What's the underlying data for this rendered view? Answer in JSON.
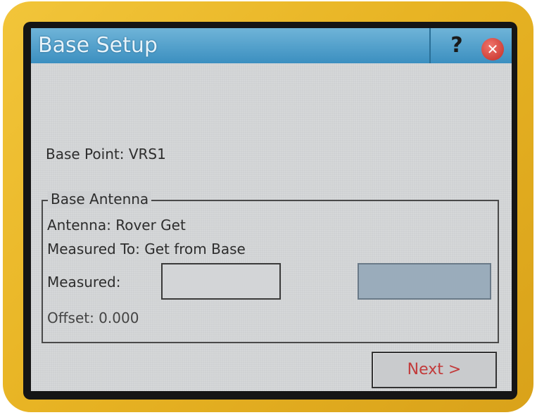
{
  "window": {
    "title": "Base Setup",
    "help_glyph": "?",
    "close_glyph": "✕"
  },
  "base_point": {
    "text": "Base Point: VRS1"
  },
  "base_antenna": {
    "group_label": "Base Antenna",
    "antenna_text": "Antenna: Rover Get",
    "measured_to_text": "Measured To: Get from Base",
    "measured_label": "Measured:",
    "measured_value": "",
    "offset_text": "Offset: 0.000"
  },
  "footer": {
    "next_label": "Next >"
  },
  "colors": {
    "titlebar": "#3b8fc0",
    "device_body": "#e8b424",
    "next_text": "#c23b3b"
  }
}
